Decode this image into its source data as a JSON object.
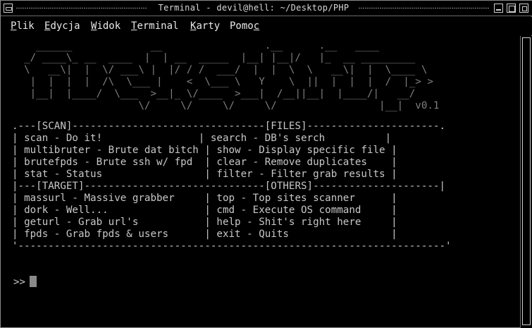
{
  "window": {
    "title": "Terminal - devil@hell: ~/Desktop/PHP"
  },
  "menubar": {
    "items": [
      {
        "accel": "P",
        "rest": "lik"
      },
      {
        "accel": "E",
        "rest": "dycja"
      },
      {
        "accel": "W",
        "rest": "idok"
      },
      {
        "accel": "T",
        "rest": "erminal"
      },
      {
        "accel": "K",
        "rest": "arty"
      },
      {
        "pre": "Pomo",
        "accel": "c",
        "rest": ""
      }
    ]
  },
  "terminal": {
    "banner": [
      "    ______             __                 .__      .__   ____",
      "  _/ ____\\_ __  ____  |  | __  _____  |__| |__|/   |_  __ _________",
      "  \\   __\\|  |  \\/ ___\\ |  |/ / /  ___/  |  |  \\  \\   __\\|  |  \\____ \\",
      "   |  |  |  |  /\\  \\___ |    <  \\___ \\   Y    \\  ||  |  |  |  /  |_> >",
      "   |__|  |____/  \\___  >__|_ \\/____  >___|  /__||__|  |____/|   __/",
      "                     \\/     \\/     \\/     \\/                 |__|  v0.1"
    ],
    "menu_table": {
      "top_border": ".---[SCAN]--------------------------------[FILES]----------------------.",
      "mid_border": "|---[TARGET]------------------------------[OTHERS]---------------------|",
      "bottom_border": "'-----------------------------------------------------------------------'",
      "scan_rows": [
        "| scan - Do it!                | search - DB's serch          |",
        "| multibruter - Brute dat bitch | show - Display specific file |",
        "| brutefpds - Brute ssh w/ fpd  | clear - Remove duplicates    |",
        "| stat - Status                 | filter - Filter grab results |"
      ],
      "target_rows": [
        "| massurl - Massive grabber     | top - Top sites scanner      |",
        "| dork - Well...                | cmd - Execute OS command     |",
        "| geturl - Grab url's           | help - Shit's right here     |",
        "| fpds - Grab fpds & users      | exit - Quits                 |"
      ]
    },
    "prompt": ">>"
  }
}
